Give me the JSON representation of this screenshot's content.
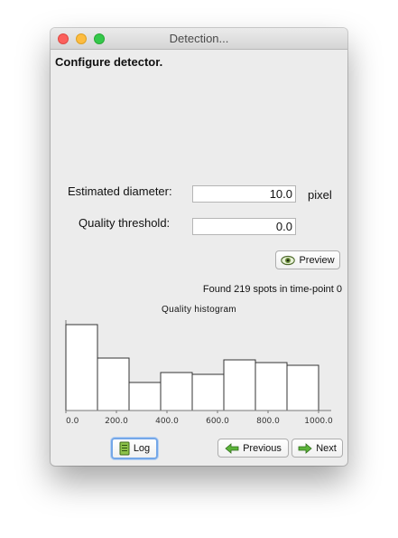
{
  "window": {
    "title": "Detection..."
  },
  "heading": "Configure detector.",
  "fields": {
    "diameter": {
      "label": "Estimated diameter:",
      "value": "10.0",
      "unit": "pixel"
    },
    "threshold": {
      "label": "Quality threshold:",
      "value": "0.0"
    }
  },
  "buttons": {
    "preview": "Preview",
    "log": "Log",
    "previous": "Previous",
    "next": "Next"
  },
  "status": "Found 219 spots in time-point 0",
  "chart_data": {
    "type": "bar",
    "title": "Quality histogram",
    "x_ticks": [
      "0.0",
      "200.0",
      "400.0",
      "600.0",
      "800.0",
      "1000.0"
    ],
    "bin_edges": [
      0,
      125,
      250,
      375,
      500,
      625,
      750,
      875,
      1000
    ],
    "values": [
      95,
      58,
      31,
      42,
      40,
      56,
      53,
      50
    ],
    "xlim": [
      0,
      1000
    ],
    "ylim": [
      0,
      100
    ],
    "grid": false,
    "legend": false
  },
  "colors": {
    "accent_focus": "#74a7e8",
    "bar_fill": "#ffffff",
    "bar_stroke": "#333333"
  },
  "icons": {
    "preview": "eye-icon",
    "log": "log-book-icon",
    "previous": "arrow-left-icon",
    "next": "arrow-right-icon"
  }
}
